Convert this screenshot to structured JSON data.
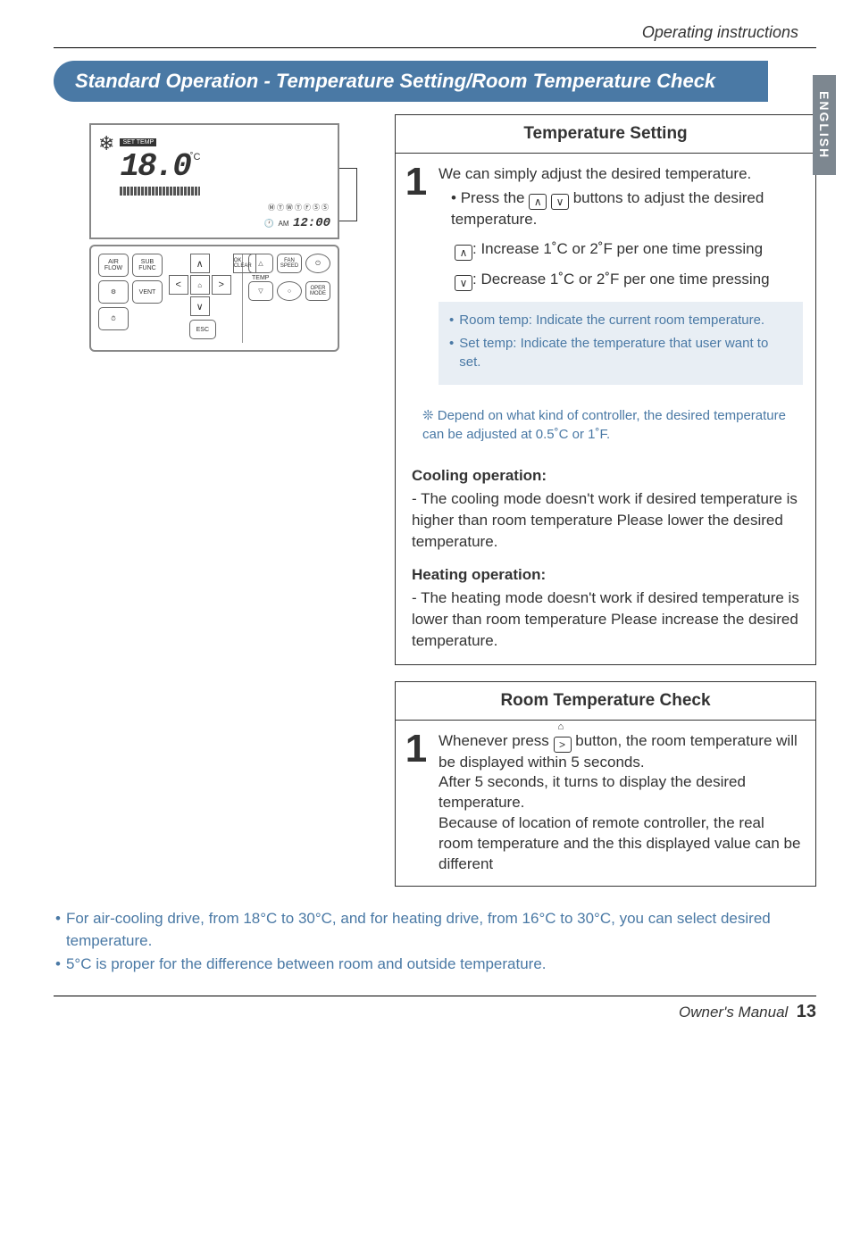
{
  "header": {
    "section": "Operating instructions",
    "lang_tab": "ENGLISH"
  },
  "banner": "Standard Operation - Temperature Setting/Room Temperature Check",
  "lcd": {
    "temp": "18.0",
    "unit": "˚C",
    "time": "12:00",
    "am": "AM",
    "set_label": "SET TEMP"
  },
  "remote_labels": {
    "air": "AIR FLOW",
    "sub": "SUB FUNC",
    "gear": "⚙",
    "vent": "VENT",
    "timer": "⏱",
    "fan": "FAN SPEED",
    "power": "⏻",
    "temp": "TEMP",
    "ok": "OK CLEAR",
    "oper": "OPER MODE",
    "esc": "ESC",
    "home": "⌂"
  },
  "temp_card": {
    "title": "Temperature Setting",
    "step1_l1": "We can simply adjust the desired temperature.",
    "step1_l2": "Press the ",
    "step1_l2b": " buttons to adjust the desired temperature.",
    "inc": ": Increase 1˚C or 2˚F per one time pressing",
    "dec": ": Decrease 1˚C or 2˚F per one time pressing",
    "note1": "Room temp: Indicate the current room temperature.",
    "note2": "Set temp: Indicate the temperature that user want to set.",
    "depend": "Depend on what kind of controller, the desired temperature can be adjusted at 0.5˚C or 1˚F.",
    "cool_h": "Cooling operation:",
    "cool_b": "- The cooling mode doesn't work if desired temperature is higher than room temperature Please lower the desired temperature.",
    "heat_h": "Heating operation:",
    "heat_b": "- The heating mode doesn't work if desired temperature is lower than room temperature Please increase the desired temperature."
  },
  "room_card": {
    "title": "Room Temperature Check",
    "body_a": "Whenever press ",
    "body_b": " button, the room temperature will be displayed within 5 seconds.",
    "body_c": "After 5 seconds, it turns to display the desired temperature.",
    "body_d": "Because of location of remote controller, the real room temperature and the this displayed value can be different"
  },
  "bottom": {
    "n1": "For air-cooling drive, from 18°C to 30°C, and for heating drive, from 16°C to 30°C, you can select desired temperature.",
    "n2": "5°C is proper for the difference between room and outside temperature."
  },
  "footer": {
    "label": "Owner's Manual",
    "page": "13"
  }
}
